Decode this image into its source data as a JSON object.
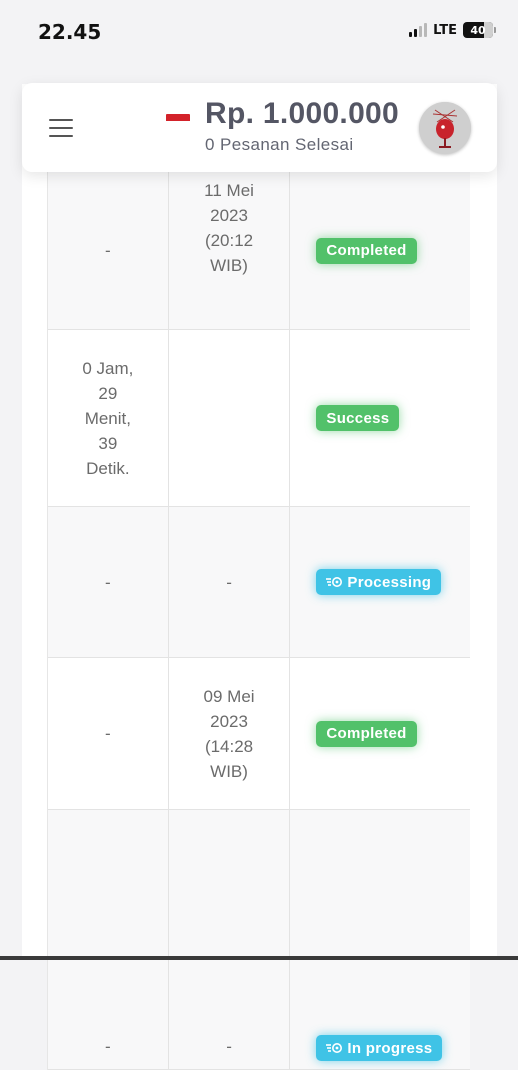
{
  "status_bar": {
    "time": "22.45",
    "network": "LTE",
    "battery": "40"
  },
  "header": {
    "flag": "indonesia-flag",
    "balance": "Rp. 1.000.000",
    "orders_label": "0 Pesanan Selesai",
    "avatar_icon": "profile-avatar"
  },
  "table": {
    "rows": [
      {
        "col1": "-",
        "col2": "11 Mei\n2023\n(20:12\nWIB)",
        "status": "Completed",
        "status_color": "#52c16a"
      },
      {
        "col1": "0 Jam,\n29\nMenit,\n39\nDetik.",
        "col2": "",
        "status": "Success",
        "status_color": "#52c16a"
      },
      {
        "col1": "-",
        "col2": "-",
        "status": "Processing",
        "status_color": "#3fc3e6",
        "status_icon": "processing-icon"
      },
      {
        "col1": "-",
        "col2": "09 Mei\n2023\n(14:28\nWIB)",
        "status": "Completed",
        "status_color": "#52c16a"
      },
      {
        "col1": "-",
        "col2": "-",
        "status": "In progress",
        "status_color": "#3fc3e6",
        "status_icon": "processing-icon"
      }
    ]
  },
  "colors": {
    "success_green": "#52c16a",
    "info_blue": "#3fc3e6",
    "flag_red": "#d3222a",
    "balance_text": "#545664"
  }
}
